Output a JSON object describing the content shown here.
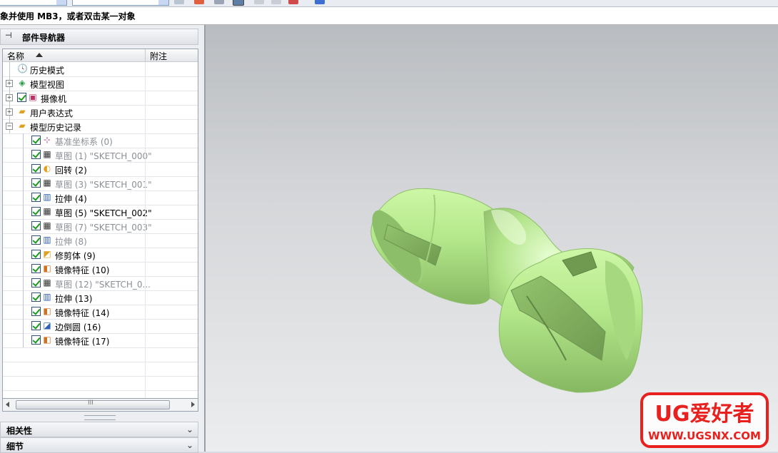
{
  "status": {
    "prompt_text": "象并使用 MB3，或者双击某一对象"
  },
  "navigator": {
    "title": "部件导航器",
    "col_name": "名称",
    "col_note": "附注",
    "items": [
      {
        "label": "历史模式",
        "icon": "clock-icon",
        "level": 0,
        "expander": "",
        "check": false,
        "dim": false
      },
      {
        "label": "模型视图",
        "icon": "model-view-icon",
        "level": 0,
        "expander": "+",
        "check": false,
        "dim": false
      },
      {
        "label": "摄像机",
        "icon": "camera-icon",
        "level": 0,
        "expander": "+",
        "check": true,
        "dim": false
      },
      {
        "label": "用户表达式",
        "icon": "folder-icon",
        "level": 0,
        "expander": "+",
        "check": false,
        "dim": false
      },
      {
        "label": "模型历史记录",
        "icon": "folder-open-icon",
        "level": 0,
        "expander": "-",
        "check": false,
        "dim": false
      },
      {
        "label": "基准坐标系 (0)",
        "icon": "datum-csys-icon",
        "level": 1,
        "check": true,
        "dim": true
      },
      {
        "label": "草图 (1) \"SKETCH_000\"",
        "icon": "sketch-icon",
        "level": 1,
        "check": true,
        "dim": true
      },
      {
        "label": "回转 (2)",
        "icon": "revolve-icon",
        "level": 1,
        "check": true,
        "dim": false
      },
      {
        "label": "草图 (3) \"SKETCH_001\"",
        "icon": "sketch-icon",
        "level": 1,
        "check": true,
        "dim": true
      },
      {
        "label": "拉伸 (4)",
        "icon": "extrude-icon",
        "level": 1,
        "check": true,
        "dim": false
      },
      {
        "label": "草图 (5) \"SKETCH_002\"",
        "icon": "sketch-icon",
        "level": 1,
        "check": true,
        "dim": false
      },
      {
        "label": "草图 (7) \"SKETCH_003\"",
        "icon": "sketch-icon",
        "level": 1,
        "check": true,
        "dim": true
      },
      {
        "label": "拉伸 (8)",
        "icon": "extrude-icon",
        "level": 1,
        "check": true,
        "dim": true
      },
      {
        "label": "修剪体 (9)",
        "icon": "trim-body-icon",
        "level": 1,
        "check": true,
        "dim": false
      },
      {
        "label": "镜像特征 (10)",
        "icon": "mirror-feature-icon",
        "level": 1,
        "check": true,
        "dim": false
      },
      {
        "label": "草图 (12) \"SKETCH_0...",
        "icon": "sketch-icon",
        "level": 1,
        "check": true,
        "dim": true
      },
      {
        "label": "拉伸 (13)",
        "icon": "extrude-icon",
        "level": 1,
        "check": true,
        "dim": false
      },
      {
        "label": "镜像特征 (14)",
        "icon": "mirror-feature-icon",
        "level": 1,
        "check": true,
        "dim": false
      },
      {
        "label": "边倒圆 (16)",
        "icon": "edge-blend-icon",
        "level": 1,
        "check": true,
        "dim": false
      },
      {
        "label": "镜像特征 (17)",
        "icon": "mirror-feature-icon",
        "level": 1,
        "check": true,
        "dim": false
      }
    ]
  },
  "sections": {
    "dependencies": "相关性",
    "details": "细节"
  },
  "scrollbar": {
    "grip": "III"
  },
  "watermark": {
    "line1": "UG爱好者",
    "line2": "WWW.UGSNX.COM"
  },
  "colors": {
    "model_green": "#b7ec8c",
    "watermark_red": "#e8211f",
    "check_green": "#1b9b1b"
  }
}
